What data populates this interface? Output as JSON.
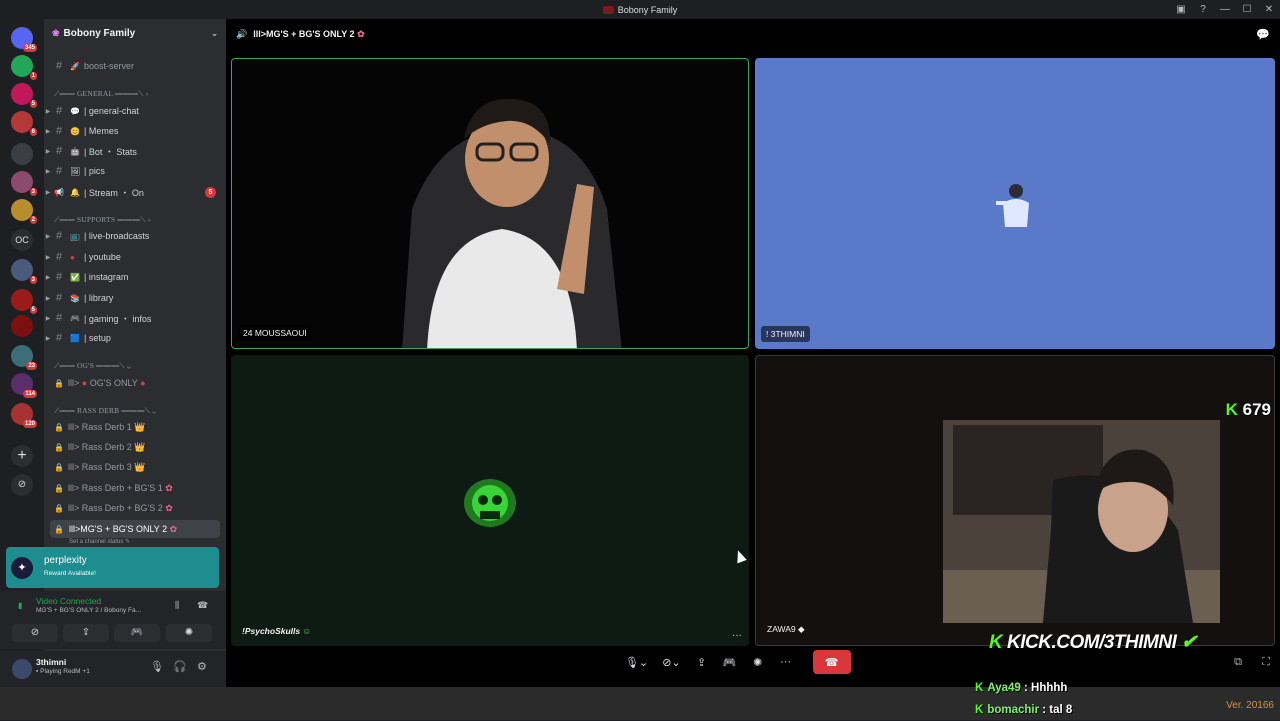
{
  "window": {
    "title": "Bobony Family"
  },
  "servers": [
    {
      "badge": "345",
      "color": "#5865f2"
    },
    {
      "badge": "1",
      "color": "#23a55a"
    },
    {
      "badge": "5",
      "color": "#c2185b"
    },
    {
      "badge": "6",
      "color": "#b33939"
    },
    {
      "badge": "",
      "color": "#3b3f45"
    },
    {
      "badge": "3",
      "color": "#8c4a6d"
    },
    {
      "badge": "2",
      "color": "#b98d2e"
    },
    {
      "badge": "",
      "color": "#2b2d31",
      "text": "OC"
    },
    {
      "badge": "3",
      "color": "#4a5a7a"
    },
    {
      "badge": "5",
      "color": "#9b1b1b"
    },
    {
      "badge": "",
      "color": "#7a1010"
    },
    {
      "badge": "23",
      "color": "#3c6e7a"
    },
    {
      "badge": "114",
      "color": "#5a2d6d"
    },
    {
      "badge": "120",
      "color": "#a83232"
    }
  ],
  "guild": {
    "name": "Bobony Family"
  },
  "channels": {
    "boost": "boost-server",
    "cat_general": "GENERAL",
    "general_chat": "| general-chat",
    "memes": "| Memes",
    "bot_stats": "| Bot ・ Stats",
    "pics": "| pics",
    "stream_on": "| Stream ・ On",
    "stream_badge": "5",
    "cat_supports": "SUPPORTS",
    "live_broadcasts": "| live-broadcasts",
    "youtube": "| youtube",
    "instagram": "| instagram",
    "library": "| library",
    "gaming_infos": "| gaming ・ infos",
    "setup": "| setup",
    "cat_ogs": "OG'S",
    "ogs_only": "OG'S ONLY",
    "cat_rass": "RASS DERB",
    "rass1": "Rass Derb 1",
    "rass2": "Rass Derb 2",
    "rass3": "Rass Derb 3",
    "rass_bg1": "Rass Derb + BG'S 1",
    "rass_bg2": "Rass Derb + BG'S 2",
    "active": "MG'S + BG'S ONLY 2",
    "set_status": "Set a channel status"
  },
  "promo": {
    "title": "perplexity",
    "subtitle": "Reward Available!"
  },
  "voice": {
    "status": "Video Connected",
    "location": "MG'S + BG'S ONLY 2 / Bobony Fa..."
  },
  "user": {
    "name": "3thimni",
    "activity": "Playing RedM +1"
  },
  "stage": {
    "channel": "MG'S + BG'S ONLY 2"
  },
  "tiles": [
    {
      "name": "24 MOUSSAOUI"
    },
    {
      "name": "! 3THIMNI"
    },
    {
      "name": "!PsychoSkulls"
    },
    {
      "name": "ZAWA9"
    }
  ],
  "overlay": {
    "kick_url": "KICK.COM/3THIMNI",
    "viewers": "679",
    "chat": [
      {
        "nick": "Aya49",
        "msg": ": Hhhhh"
      },
      {
        "nick": "bomachir",
        "msg": ": tal 8"
      }
    ],
    "version": "Ver. 20166"
  }
}
